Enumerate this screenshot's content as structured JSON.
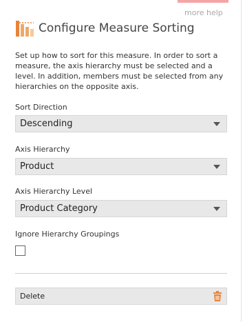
{
  "header": {
    "more_help": "more help",
    "title": "Configure Measure Sorting",
    "icon": "sort-chart-icon"
  },
  "description": "Set up how to sort for this measure. In order to sort a measure, the axis hierarchy must be selected and a level. In addition, members must be selected from any hierarchies on the opposite axis.",
  "fields": {
    "sort_direction": {
      "label": "Sort Direction",
      "value": "Descending"
    },
    "axis_hierarchy": {
      "label": "Axis Hierarchy",
      "value": "Product"
    },
    "axis_hierarchy_level": {
      "label": "Axis Hierarchy Level",
      "value": "Product Category"
    },
    "ignore_groupings": {
      "label": "Ignore Hierarchy Groupings",
      "checked": false
    }
  },
  "actions": {
    "delete_label": "Delete",
    "delete_icon": "trash-icon"
  },
  "colors": {
    "accent": "#e8833a",
    "more_help_bar": "#f4a6a6"
  }
}
